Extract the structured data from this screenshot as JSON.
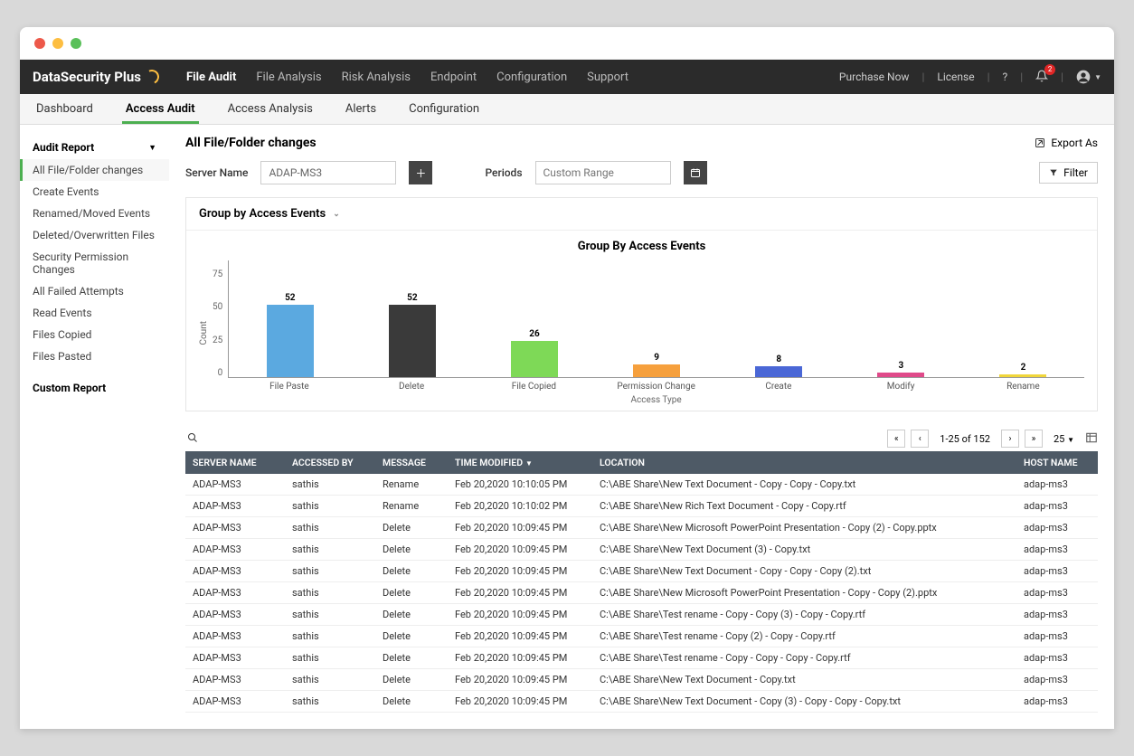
{
  "app": {
    "name": "DataSecurity Plus"
  },
  "topnav": {
    "items": [
      "File Audit",
      "File Analysis",
      "Risk Analysis",
      "Endpoint",
      "Configuration",
      "Support"
    ],
    "active": 0
  },
  "topright": {
    "purchase": "Purchase Now",
    "license": "License",
    "help": "?",
    "notif_count": "2"
  },
  "subnav": {
    "items": [
      "Dashboard",
      "Access Audit",
      "Access Analysis",
      "Alerts",
      "Configuration"
    ],
    "active": 1
  },
  "sidebar": {
    "header": "Audit Report",
    "items": [
      "All File/Folder changes",
      "Create Events",
      "Renamed/Moved Events",
      "Deleted/Overwritten Files",
      "Security Permission Changes",
      "All Failed Attempts",
      "Read Events",
      "Files Copied",
      "Files Pasted"
    ],
    "custom": "Custom Report"
  },
  "page": {
    "title": "All File/Folder changes",
    "export": "Export As",
    "server_label": "Server Name",
    "server_value": "ADAP-MS3",
    "period_label": "Periods",
    "period_placeholder": "Custom Range",
    "filter": "Filter"
  },
  "chart_panel": {
    "title": "Group by Access Events"
  },
  "chart_data": {
    "type": "bar",
    "title": "Group By Access Events",
    "xlabel": "Access Type",
    "ylabel": "Count",
    "ylim": [
      0,
      75
    ],
    "yticks": [
      0,
      25,
      50,
      75
    ],
    "categories": [
      "File Paste",
      "Delete",
      "File Copied",
      "Permission Change",
      "Create",
      "Modify",
      "Rename"
    ],
    "values": [
      52,
      52,
      26,
      9,
      8,
      3,
      2
    ],
    "colors": [
      "#5ba9e0",
      "#3a3a3a",
      "#7ed957",
      "#f6a03d",
      "#4a67d6",
      "#e04a8a",
      "#f0d63b"
    ]
  },
  "pager": {
    "range": "1-25 of 152",
    "size": "25"
  },
  "table": {
    "columns": [
      "SERVER NAME",
      "ACCESSED BY",
      "MESSAGE",
      "TIME MODIFIED",
      "LOCATION",
      "HOST NAME"
    ],
    "rows": [
      [
        "ADAP-MS3",
        "sathis",
        "Rename",
        "Feb 20,2020 10:10:05 PM",
        "C:\\ABE Share\\New Text Document - Copy - Copy - Copy.txt",
        "adap-ms3"
      ],
      [
        "ADAP-MS3",
        "sathis",
        "Rename",
        "Feb 20,2020 10:10:02 PM",
        "C:\\ABE Share\\New Rich Text Document - Copy - Copy.rtf",
        "adap-ms3"
      ],
      [
        "ADAP-MS3",
        "sathis",
        "Delete",
        "Feb 20,2020 10:09:45 PM",
        "C:\\ABE Share\\New Microsoft PowerPoint Presentation - Copy (2) - Copy.pptx",
        "adap-ms3"
      ],
      [
        "ADAP-MS3",
        "sathis",
        "Delete",
        "Feb 20,2020 10:09:45 PM",
        "C:\\ABE Share\\New Text Document (3) - Copy.txt",
        "adap-ms3"
      ],
      [
        "ADAP-MS3",
        "sathis",
        "Delete",
        "Feb 20,2020 10:09:45 PM",
        "C:\\ABE Share\\New Text Document - Copy - Copy - Copy (2).txt",
        "adap-ms3"
      ],
      [
        "ADAP-MS3",
        "sathis",
        "Delete",
        "Feb 20,2020 10:09:45 PM",
        "C:\\ABE Share\\New Microsoft PowerPoint Presentation - Copy - Copy (2).pptx",
        "adap-ms3"
      ],
      [
        "ADAP-MS3",
        "sathis",
        "Delete",
        "Feb 20,2020 10:09:45 PM",
        "C:\\ABE Share\\Test rename - Copy - Copy (3) - Copy - Copy.rtf",
        "adap-ms3"
      ],
      [
        "ADAP-MS3",
        "sathis",
        "Delete",
        "Feb 20,2020 10:09:45 PM",
        "C:\\ABE Share\\Test rename - Copy (2) - Copy - Copy.rtf",
        "adap-ms3"
      ],
      [
        "ADAP-MS3",
        "sathis",
        "Delete",
        "Feb 20,2020 10:09:45 PM",
        "C:\\ABE Share\\Test rename - Copy - Copy - Copy - Copy.rtf",
        "adap-ms3"
      ],
      [
        "ADAP-MS3",
        "sathis",
        "Delete",
        "Feb 20,2020 10:09:45 PM",
        "C:\\ABE Share\\New Text Document - Copy.txt",
        "adap-ms3"
      ],
      [
        "ADAP-MS3",
        "sathis",
        "Delete",
        "Feb 20,2020 10:09:45 PM",
        "C:\\ABE Share\\New Text Document - Copy (3) - Copy - Copy - Copy.txt",
        "adap-ms3"
      ]
    ]
  }
}
